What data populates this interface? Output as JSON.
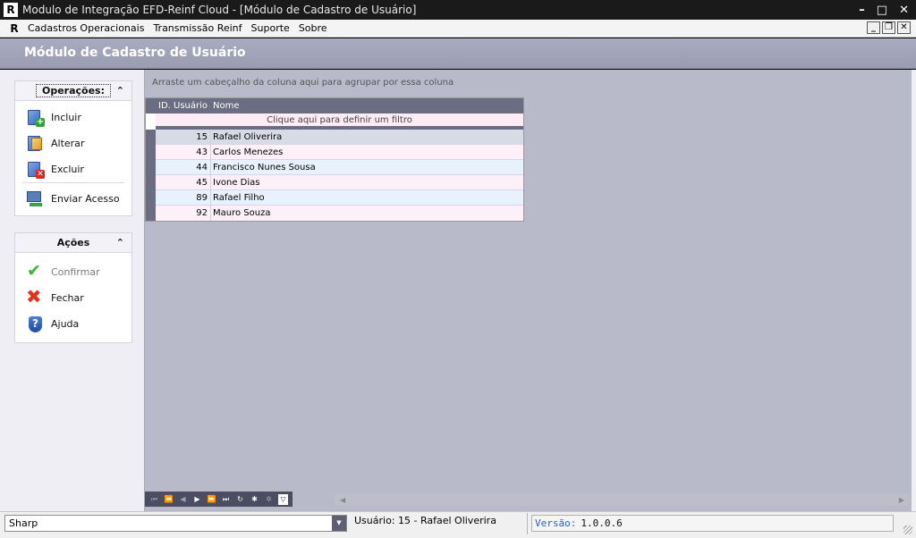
{
  "window": {
    "title": "Modulo de Integração EFD-Reinf Cloud - [Módulo de Cadastro de Usuário]",
    "logo_letter": "R"
  },
  "menu": {
    "items": [
      "Cadastros Operacionais",
      "Transmissão Reinf",
      "Suporte",
      "Sobre"
    ]
  },
  "page": {
    "title": "Módulo de Cadastro de Usuário"
  },
  "operations": {
    "header": "Operações:",
    "items": [
      "Incluir",
      "Alterar",
      "Excluir",
      "Enviar Acesso"
    ]
  },
  "actions": {
    "header": "Ações",
    "items": [
      "Confirmar",
      "Fechar",
      "Ajuda"
    ]
  },
  "grid": {
    "group_hint": "Arraste um cabeçalho da coluna aqui para agrupar por essa coluna",
    "columns": [
      "ID. Usuário",
      "Nome"
    ],
    "filter_hint": "Clique aqui para definir um filtro",
    "rows": [
      {
        "id": "15",
        "name": "Rafael Oliverira"
      },
      {
        "id": "43",
        "name": "Carlos Menezes"
      },
      {
        "id": "44",
        "name": "Francisco Nunes Sousa"
      },
      {
        "id": "45",
        "name": "Ivone Dias"
      },
      {
        "id": "89",
        "name": "Rafael Filho"
      },
      {
        "id": "92",
        "name": "Mauro Souza"
      }
    ]
  },
  "status": {
    "database": "Sharp",
    "user": "Usuário: 15 - Rafael Oliverira",
    "version_label": "Versão:",
    "version_value": "1.0.0.6"
  },
  "colors": {
    "header_band": "#a9abc0",
    "grid_background": "#b9bac9",
    "grid_header": "#6b6d82",
    "row_alt_blue": "#e8f2fc",
    "row_alt_pink": "#fdf0f8"
  }
}
